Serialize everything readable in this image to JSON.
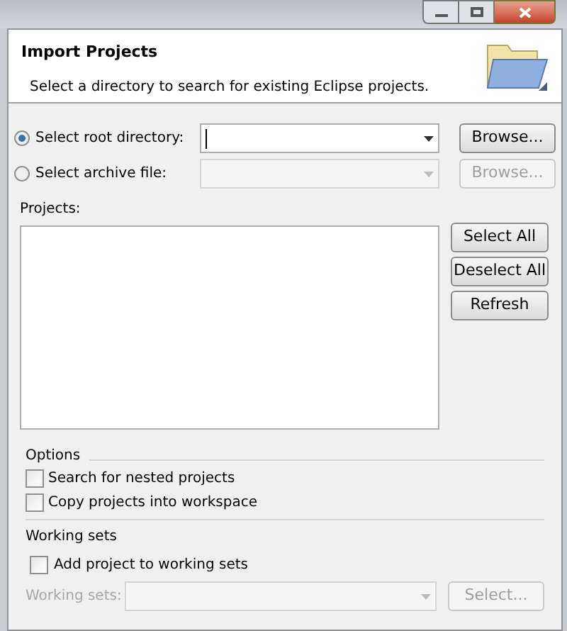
{
  "header": {
    "title": "Import Projects",
    "description": "Select a directory to search for existing Eclipse projects."
  },
  "sources": [
    {
      "label": "Select root directory:",
      "selected": true,
      "disabled": false,
      "button": "Browse..."
    },
    {
      "label": "Select archive file:",
      "selected": false,
      "disabled": true,
      "button": "Browse..."
    }
  ],
  "projects": {
    "label": "Projects:",
    "buttons": [
      "Select All",
      "Deselect All",
      "Refresh"
    ]
  },
  "options": {
    "title": "Options",
    "items": [
      {
        "label": "Search for nested projects",
        "checked": false
      },
      {
        "label": "Copy projects into workspace",
        "checked": false
      }
    ]
  },
  "working_sets": {
    "title": "Working sets",
    "add": {
      "label": "Add project to working sets",
      "checked": false
    },
    "field_label": "Working sets:",
    "button": "Select...",
    "disabled": true
  }
}
